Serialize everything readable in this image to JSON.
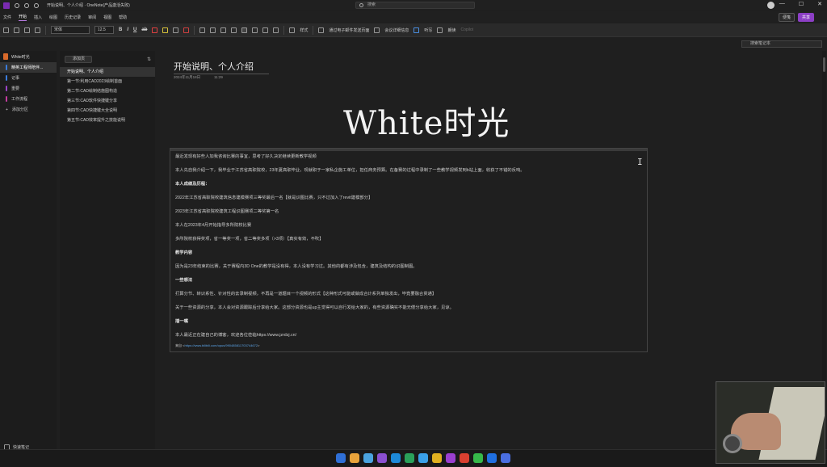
{
  "titlebar": {
    "doc_title": "开始说明、个人介绍  ·  OneNote(产品激活失败)",
    "search_placeholder": "搜索",
    "user_chip_minimize": "—",
    "user_chip_maximize": "☐",
    "user_chip_close": "✕"
  },
  "menu": {
    "items": [
      "文件",
      "开始",
      "插入",
      "绘图",
      "历史记录",
      "审阅",
      "视图",
      "帮助"
    ],
    "sticky_label": "便笺",
    "share_label": "共享"
  },
  "ribbon": {
    "font": "宋体",
    "size": "12.5",
    "bold": "B",
    "italic": "I",
    "underline": "U",
    "strike": "ab",
    "styles_label": "样式",
    "email_label": "通过电子邮件发送页面",
    "meeting_label": "会议详细信息",
    "dictate_label": "听写",
    "read_label": "朗读",
    "copilot_label": "Copilot"
  },
  "nb_search": {
    "placeholder": "搜索笔记本"
  },
  "sections": {
    "notebook": "White时光",
    "items": [
      {
        "label": "精英工程师陪伴...",
        "color": "#3b7ddd"
      },
      {
        "label": "记事",
        "color": "#3b7ddd"
      },
      {
        "label": "重要",
        "color": "#9b45c8"
      },
      {
        "label": "工作流程",
        "color": "#c43ca0"
      }
    ],
    "add_section": "添加分区",
    "quick_notes": "快速笔记"
  },
  "pages": {
    "add_page": "添加页",
    "items": [
      "开始说明、个人介绍",
      "第一节:利用CAD2023绘制首面",
      "第二节:CAD绘制结施图构造",
      "第三节:CAD软件快捷键分享",
      "第四节:CAD快捷键大全说明",
      "第五节:CAD效率提升之技能说明"
    ]
  },
  "page": {
    "title": "开始说明、个人介绍",
    "date": "2024年11月18日",
    "time": "11:29",
    "heading": "White时光",
    "paragraphs": [
      {
        "text": "最近发现有好些人加我咨询比赛的事宜，思考了好久决定继续更新教学视频",
        "style": "p"
      },
      {
        "text": "本人先自我介绍一下，我毕业于江苏省高职院校，23年夏高职毕业，现就职于一家私企施工单位，担任商务预算。在备赛的过程中录制了一些教学视频发到b站上面，收获了不错的反响。",
        "style": "p"
      },
      {
        "text": "本人成绩及历程：",
        "style": "h"
      },
      {
        "text": "2022年江苏省高职院校建筑信息建模赛项三等奖最后一名【就是识图比赛，只不过加入了revit建模部分】",
        "style": "p"
      },
      {
        "text": "2023年江苏省高职院校建筑工程识图赛项二等奖第一名",
        "style": "p"
      },
      {
        "text": "本人在2023年4月开始指导多所院校比赛",
        "style": "p"
      },
      {
        "text": "多所院校获得奖项，省一等奖一项，省二等奖多项（>3项）【真实有效，不吹】",
        "style": "p"
      },
      {
        "text": "教学内容",
        "style": "h"
      },
      {
        "text": "因为是23年结束的比赛，关于赛程内3D One的教学是没有得，本人没有学习过。其他的都有涉及包含，建筑及结构的识图制图。",
        "style": "p"
      },
      {
        "text": "一些想法",
        "style": "h"
      },
      {
        "text": "打算分节、转识系性、针对性的去录制视频，不再是一道题目一个视频的形式【这种形式可能或做成合计系列单独发出，毕竟要融合贯通】",
        "style": "p"
      },
      {
        "text": "关于一些资源的分享，本人会对资源跟踪后分享给大家。这部分资源也是up主觉得可以自行发给大家的，有些资源确实不能无偿分享给大家，见谅。",
        "style": "p"
      },
      {
        "text": "插一嘴",
        "style": "h"
      },
      {
        "text": "本人最近正在建自己的博客，欢迎各位莅临https://www.jzrdzj.cn/",
        "style": "p"
      }
    ],
    "source_prefix": "来自 <",
    "source_link": "https://www.bilibili.com/opus/990485811703744672",
    "source_suffix": ">"
  },
  "taskbar": {
    "apps": [
      "#2f6fd6",
      "#e8a33b",
      "#4aa3df",
      "#8a4fd0",
      "#1d89d8",
      "#2aa15a",
      "#3aa0e8",
      "#e0b020",
      "#9b3fd0",
      "#d94030",
      "#36b94a",
      "#1f6fe0",
      "#4a6ee0"
    ]
  }
}
